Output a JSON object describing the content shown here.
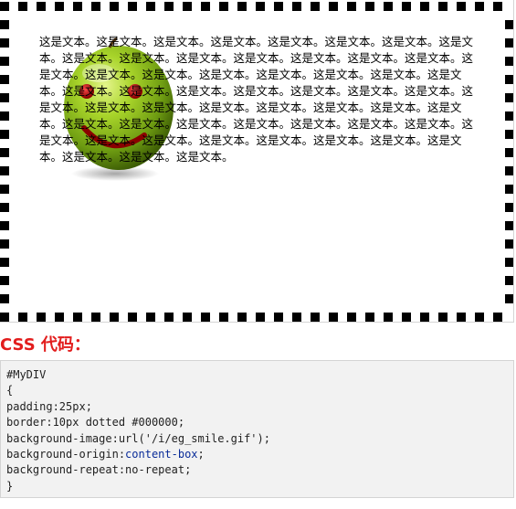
{
  "demo": {
    "text": "这是文本。这是文本。这是文本。这是文本。这是文本。这是文本。这是文本。这是文本。这是文本。这是文本。这是文本。这是文本。这是文本。这是文本。这是文本。这是文本。这是文本。这是文本。这是文本。这是文本。这是文本。这是文本。这是文本。这是文本。这是文本。这是文本。这是文本。这是文本。这是文本。这是文本。这是文本。这是文本。这是文本。这是文本。这是文本。这是文本。这是文本。这是文本。这是文本。这是文本。这是文本。这是文本。这是文本。这是文本。这是文本。这是文本。这是文本。这是文本。这是文本。这是文本。这是文本。这是文本。这是文本。这是文本。这是文本。这是文本。",
    "border_color": "#000000",
    "background_image": "smiley-face-icon"
  },
  "css_section": {
    "heading": "CSS 代码：",
    "heading_color": "#e21d1d"
  },
  "code": {
    "line_1": "#MyDIV",
    "line_2": "{",
    "line_3a": "padding:25px;",
    "line_4a": "border:10px dotted #000000;",
    "line_5a": "background-image:url('/i/eg_smile.gif');",
    "line_6a": "background-origin:",
    "line_6b": "content-box",
    "line_6c": ";",
    "line_7a": "background-repeat:no-repeat;",
    "line_8": "}"
  }
}
